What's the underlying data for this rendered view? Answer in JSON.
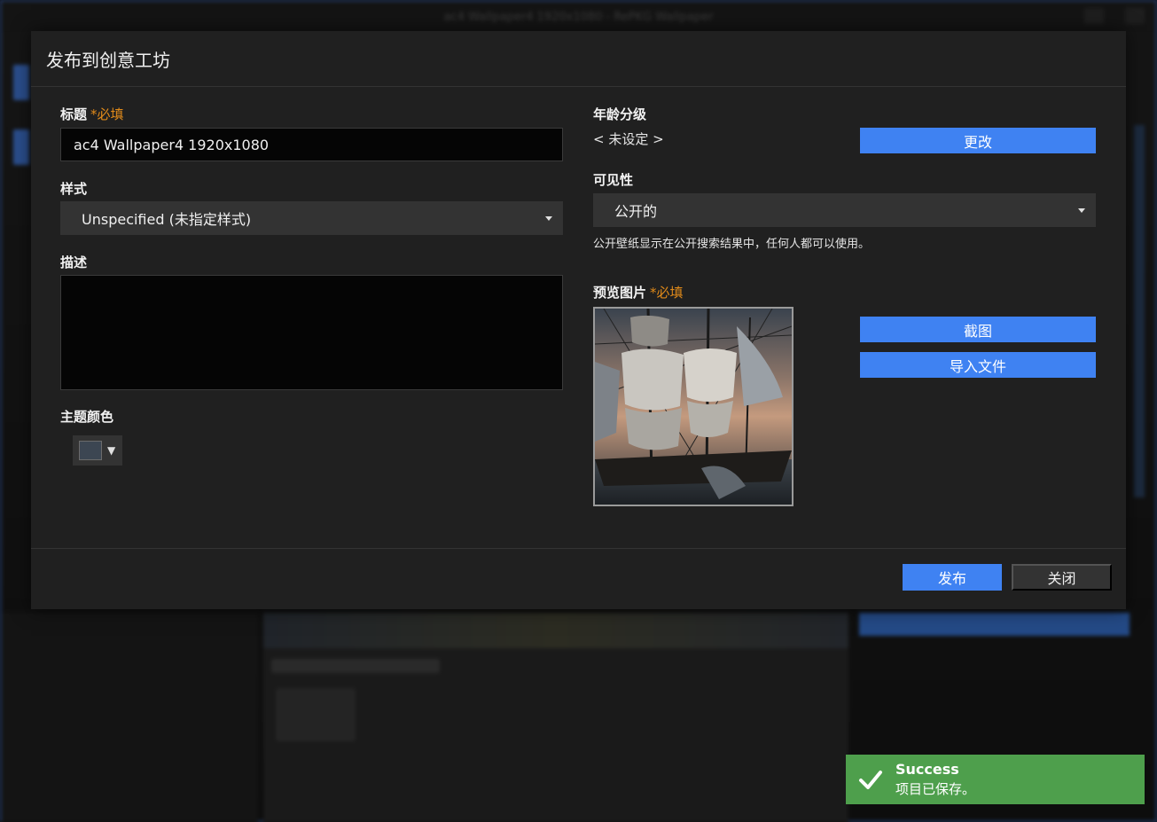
{
  "background": {
    "title": "ac4 Wallpaper4 1920x1080 - RePKG Wallpaper"
  },
  "dialog": {
    "title": "发布到创意工坊",
    "title_field": {
      "label": "标题",
      "required": "*必填",
      "value": "ac4 Wallpaper4 1920x1080"
    },
    "style_field": {
      "label": "样式",
      "selected": "Unspecified (未指定样式)"
    },
    "description_field": {
      "label": "描述",
      "value": ""
    },
    "theme_color": {
      "label": "主题颜色",
      "color": "#3c4652"
    },
    "age_rating": {
      "label": "年龄分级",
      "value": "< 未设定 >",
      "change_button": "更改"
    },
    "visibility": {
      "label": "可见性",
      "selected": "公开的",
      "hint": "公开壁纸显示在公开搜索结果中，任何人都可以使用。"
    },
    "preview": {
      "label": "预览图片",
      "required": "*必填",
      "screenshot_button": "截图",
      "import_button": "导入文件"
    },
    "footer": {
      "publish_button": "发布",
      "close_button": "关闭"
    }
  },
  "toast": {
    "title": "Success",
    "message": "项目已保存。",
    "color": "#4e9f4c"
  },
  "colors": {
    "accent": "#3f82f2",
    "required": "#e08a1a"
  }
}
